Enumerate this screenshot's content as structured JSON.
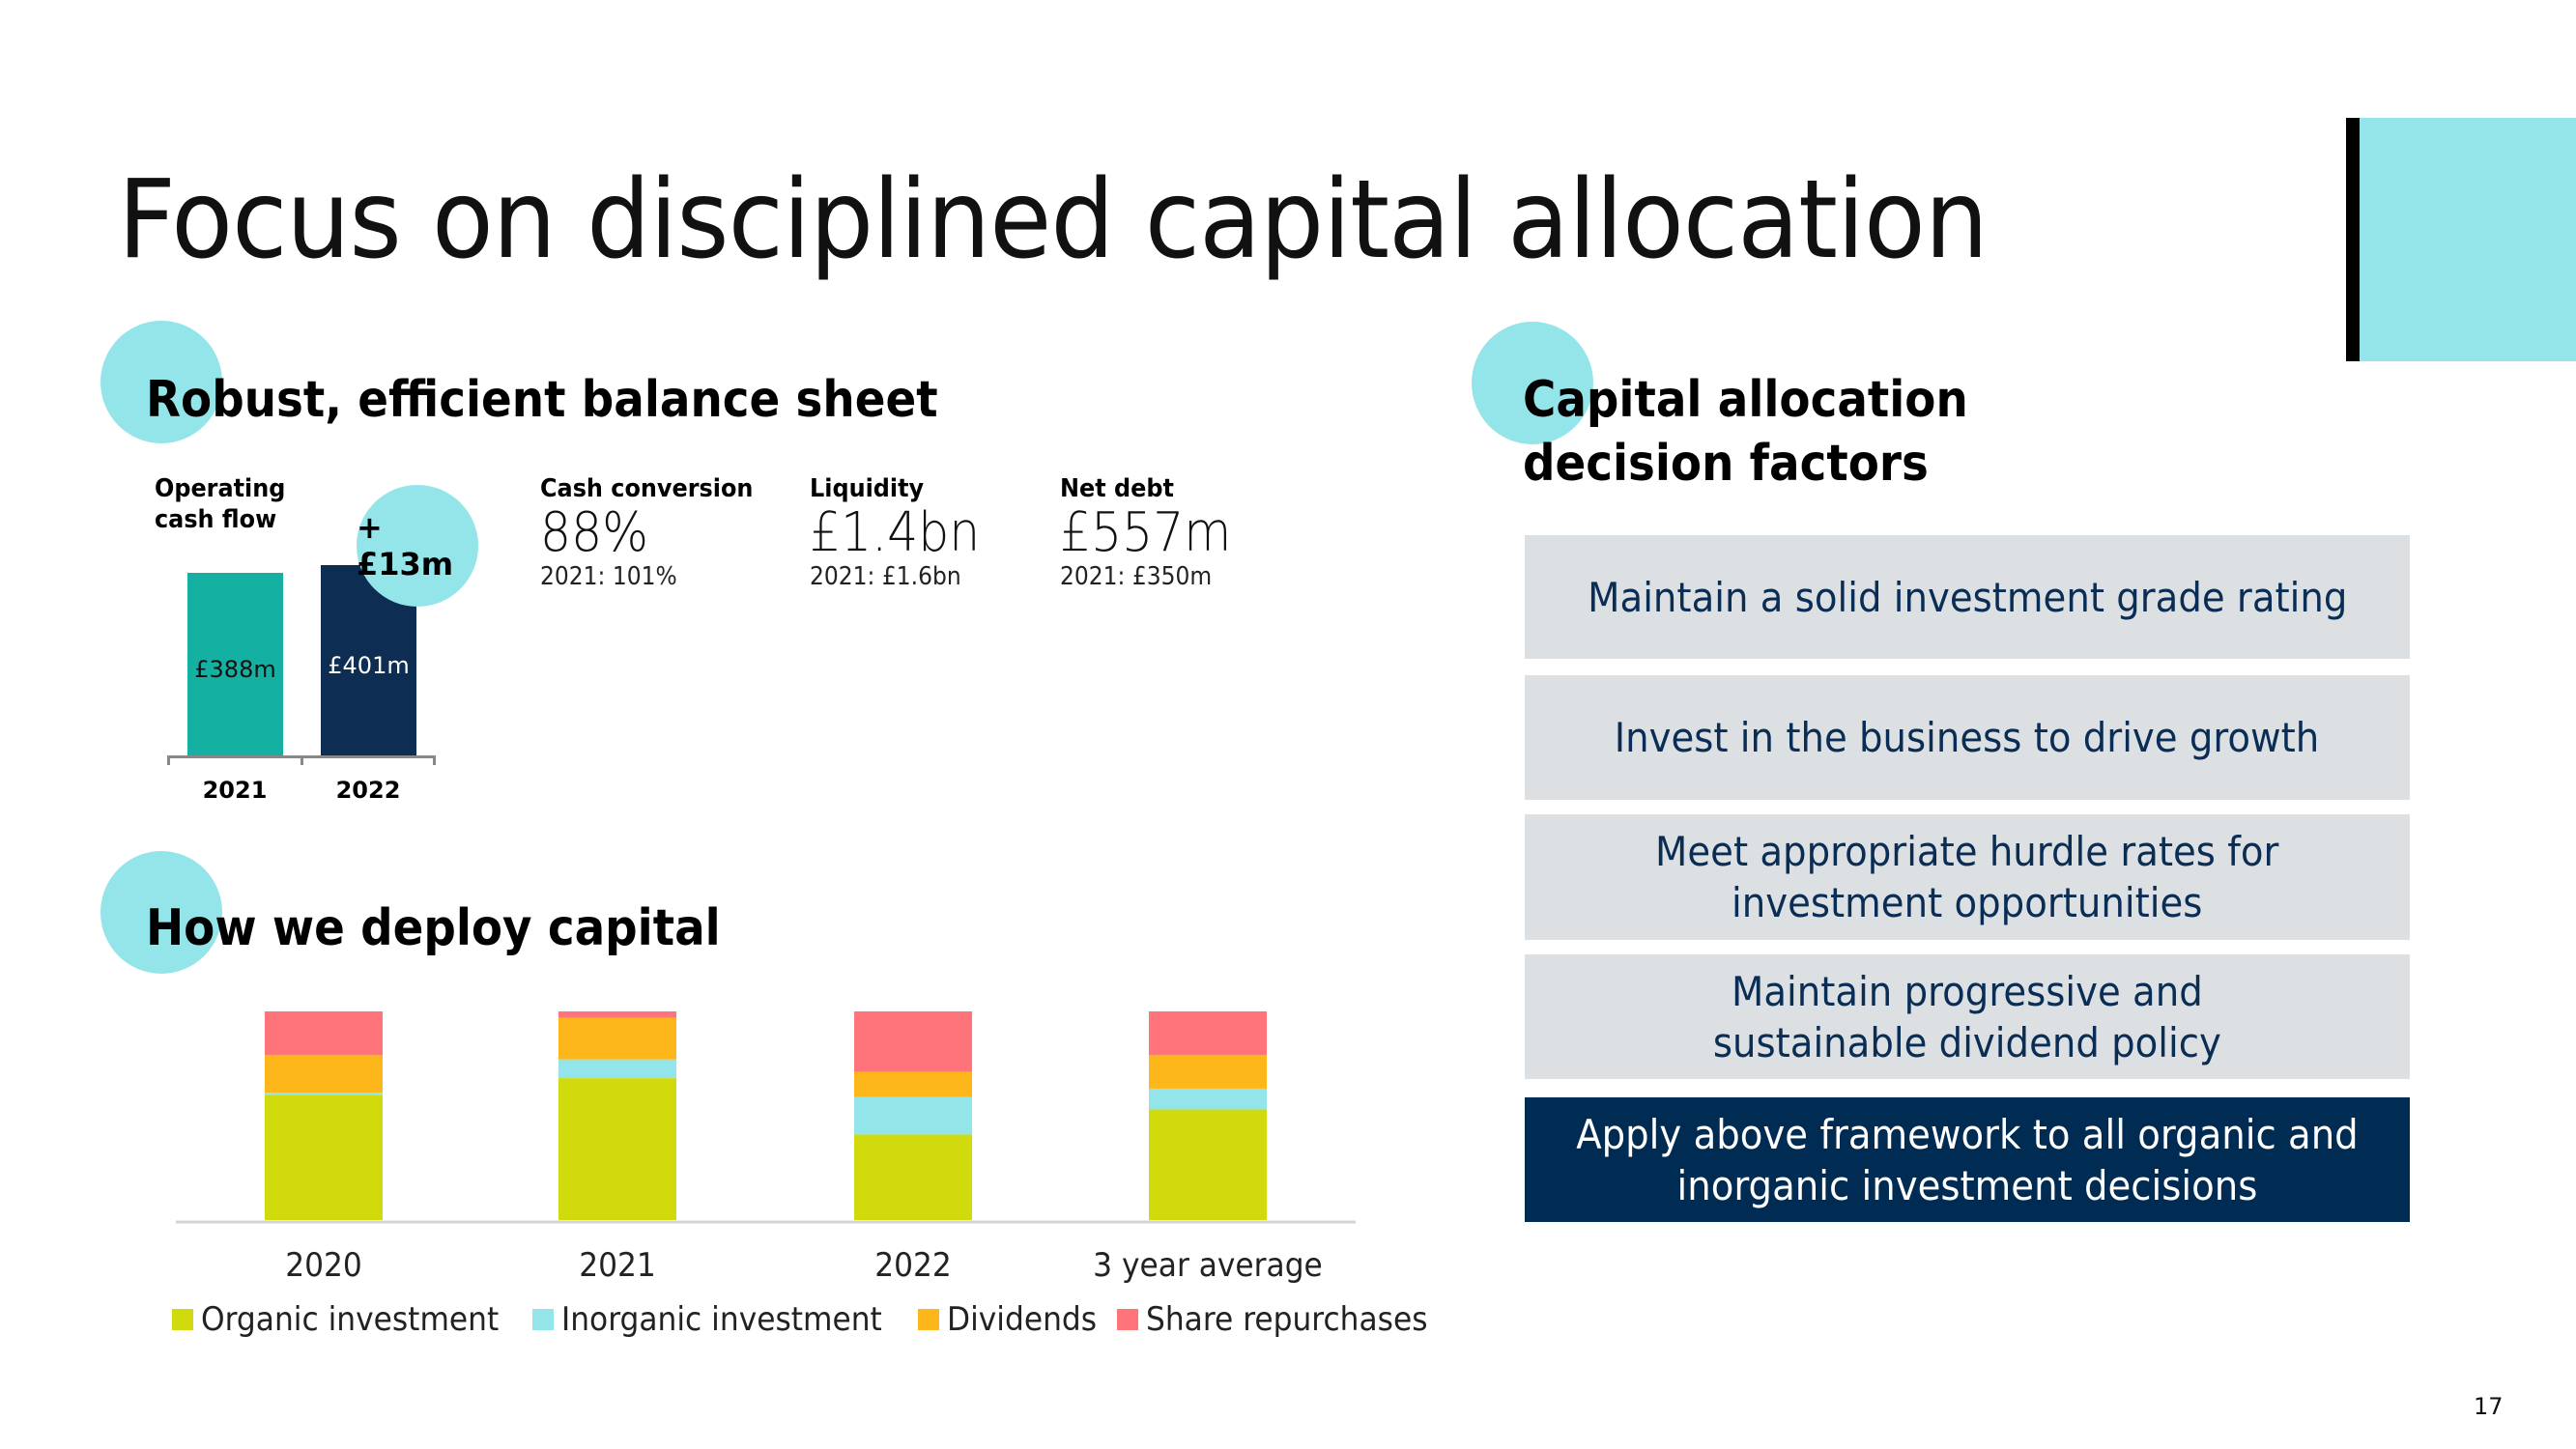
{
  "slide": {
    "title": "Focus on disciplined capital allocation",
    "page_number": "17"
  },
  "balance_sheet": {
    "heading": "Robust, efficient balance sheet",
    "operating_cash_flow": {
      "label_line1": "Operating",
      "label_line2": "cash flow",
      "delta": "+£13m",
      "bars": [
        {
          "year": "2021",
          "label": "£388m",
          "value": 388,
          "color": "#14b1a3"
        },
        {
          "year": "2022",
          "label": "£401m",
          "value": 401,
          "color": "#0d2d52"
        }
      ]
    },
    "kpis": [
      {
        "label": "Cash conversion",
        "value": "88%",
        "prior": "2021: 101%"
      },
      {
        "label": "Liquidity",
        "value": "£1.4bn",
        "prior": "2021: £1.6bn"
      },
      {
        "label": "Net debt",
        "value": "£557m",
        "prior": "2021: £350m"
      }
    ]
  },
  "deploy": {
    "heading": "How we deploy capital"
  },
  "chart_data": {
    "type": "bar",
    "stacked": true,
    "title": "How we deploy capital",
    "xlabel": "",
    "ylabel": "",
    "ylim": [
      0,
      100
    ],
    "grid": false,
    "legend_position": "bottom",
    "categories": [
      "2020",
      "2021",
      "2022",
      "3 year average"
    ],
    "series": [
      {
        "name": "Organic investment",
        "color": "#d1da0c",
        "values": [
          60,
          68,
          41,
          53
        ]
      },
      {
        "name": "Inorganic investment",
        "color": "#94e5ea",
        "values": [
          1,
          9,
          18,
          10
        ]
      },
      {
        "name": "Dividends",
        "color": "#fdb71a",
        "values": [
          18,
          20,
          12,
          16
        ]
      },
      {
        "name": "Share repurchases",
        "color": "#ff737a",
        "values": [
          21,
          3,
          29,
          21
        ]
      }
    ]
  },
  "decision_factors": {
    "heading_line1": "Capital allocation",
    "heading_line2": "decision factors",
    "items": [
      {
        "line1": "Maintain a solid investment grade rating",
        "line2": ""
      },
      {
        "line1": "Invest in the business to drive growth",
        "line2": ""
      },
      {
        "line1": "Meet appropriate hurdle rates for",
        "line2": "investment opportunities"
      },
      {
        "line1": "Maintain progressive and",
        "line2": "sustainable dividend policy"
      },
      {
        "line1": "Apply above framework to all organic and",
        "line2": "inorganic investment decisions"
      }
    ]
  },
  "colors": {
    "accent_cyan": "#94e5ea",
    "navy": "#002b53",
    "factor_grey": "#dde0e2"
  }
}
